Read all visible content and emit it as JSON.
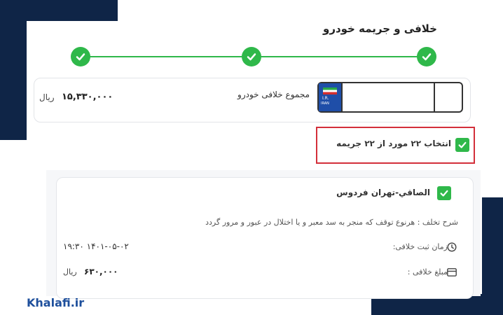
{
  "page": {
    "title": "خلافی و جریمه خودرو"
  },
  "stepper": {
    "steps": [
      "completed",
      "completed",
      "completed"
    ],
    "accent_color": "#2fb84a"
  },
  "summary": {
    "total_label": "مجموع خلافی خودرو",
    "total_amount": "۱۵,۳۳۰,۰۰۰",
    "currency": "ریال"
  },
  "select_all": {
    "label": "انتخاب ۲۲ مورد از ۲۲ جریمه",
    "checked": true,
    "highlight_color": "#d32f3a"
  },
  "violation": {
    "location": "الصاقي-تهران فردوس",
    "description": "شرح تخلف : هرنوع توقف که منجر به سد معبر و یا اختلال در عبور و مرور گردد",
    "time_label": "زمان ثبت خلافی:",
    "time_value": "۱۹:۳۰ ۱۴۰۱-۰۵-۰۲",
    "fine_label": "مبلغ خلافی :",
    "fine_amount": "۶۳۰,۰۰۰",
    "fine_currency": "ریال",
    "checked": true
  },
  "brand": {
    "name": "Khalafi.ir",
    "color": "#1e4f9c"
  },
  "theme": {
    "navy": "#0f2547"
  }
}
